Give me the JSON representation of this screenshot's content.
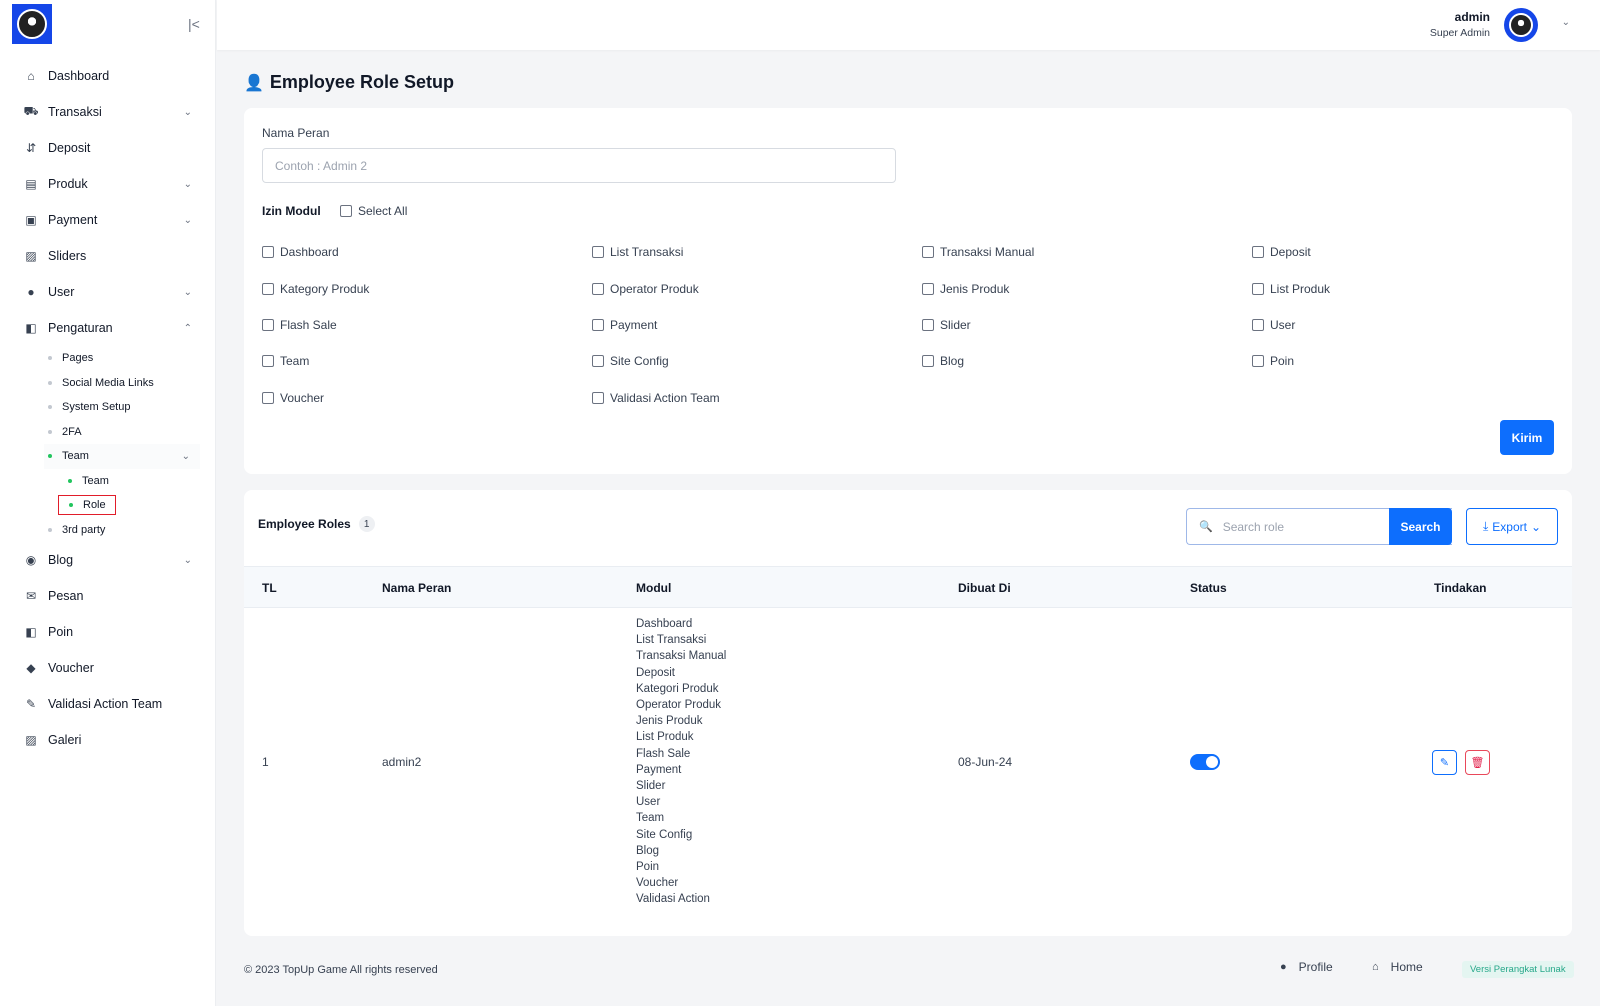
{
  "sidebar": {
    "collapse_icon": "collapse-left-icon",
    "items": [
      {
        "label": "Dashboard",
        "icon": "home-icon"
      },
      {
        "label": "Transaksi",
        "icon": "cart-icon"
      },
      {
        "label": "Deposit",
        "icon": "deposit-icon"
      },
      {
        "label": "Produk",
        "icon": "store-icon"
      },
      {
        "label": "Payment",
        "icon": "payment-icon"
      },
      {
        "label": "Sliders",
        "icon": "image-icon"
      },
      {
        "label": "User",
        "icon": "user-icon"
      },
      {
        "label": "Pengaturan",
        "icon": "settings-icon"
      },
      {
        "label": "Blog",
        "icon": "blog-icon"
      },
      {
        "label": "Pesan",
        "icon": "mail-icon"
      },
      {
        "label": "Poin",
        "icon": "points-icon"
      },
      {
        "label": "Voucher",
        "icon": "tag-icon"
      },
      {
        "label": "Validasi Action Team",
        "icon": "validate-icon"
      },
      {
        "label": "Galeri",
        "icon": "gallery-icon"
      }
    ],
    "pengaturan_sub": [
      "Pages",
      "Social Media Links",
      "System Setup",
      "2FA",
      "Team",
      "3rd party"
    ],
    "team_sub": [
      "Team",
      "Role"
    ]
  },
  "header": {
    "user_name": "admin",
    "user_role": "Super Admin"
  },
  "page": {
    "title": "Employee Role Setup"
  },
  "form": {
    "name_label": "Nama Peran",
    "name_placeholder": "Contoh : Admin 2",
    "name_value": "",
    "izin_label": "Izin Modul",
    "select_all_label": "Select All",
    "modules": [
      "Dashboard",
      "List Transaksi",
      "Transaksi Manual",
      "Deposit",
      "Kategory Produk",
      "Operator Produk",
      "Jenis Produk",
      "List Produk",
      "Flash Sale",
      "Payment",
      "Slider",
      "User",
      "Team",
      "Site Config",
      "Blog",
      "Poin",
      "Voucher",
      "Validasi Action Team"
    ],
    "submit_label": "Kirim"
  },
  "table": {
    "title": "Employee Roles",
    "count": "1",
    "search_placeholder": "Search role",
    "search_label": "Search",
    "export_label": "Export",
    "columns": [
      "TL",
      "Nama Peran",
      "Modul",
      "Dibuat Di",
      "Status",
      "Tindakan"
    ],
    "rows": [
      {
        "tl": "1",
        "name": "admin2",
        "modules": [
          "Dashboard",
          "List Transaksi",
          "Transaksi Manual",
          "Deposit",
          "Kategori Produk",
          "Operator Produk",
          "Jenis Produk",
          "List Produk",
          "Flash Sale",
          "Payment",
          "Slider",
          "User",
          "Team",
          "Site Config",
          "Blog",
          "Poin",
          "Voucher",
          "Validasi Action"
        ],
        "created": "08-Jun-24",
        "status_on": true
      }
    ]
  },
  "footer": {
    "copyright": "© 2023 TopUp Game All rights reserved",
    "profile_label": "Profile",
    "home_label": "Home",
    "version_label": "Versi Perangkat Lunak"
  },
  "colors": {
    "primary": "#0d6efd",
    "logo_bg": "#1546e8",
    "danger": "#e11d48",
    "highlight_box": "#e11d2a"
  }
}
